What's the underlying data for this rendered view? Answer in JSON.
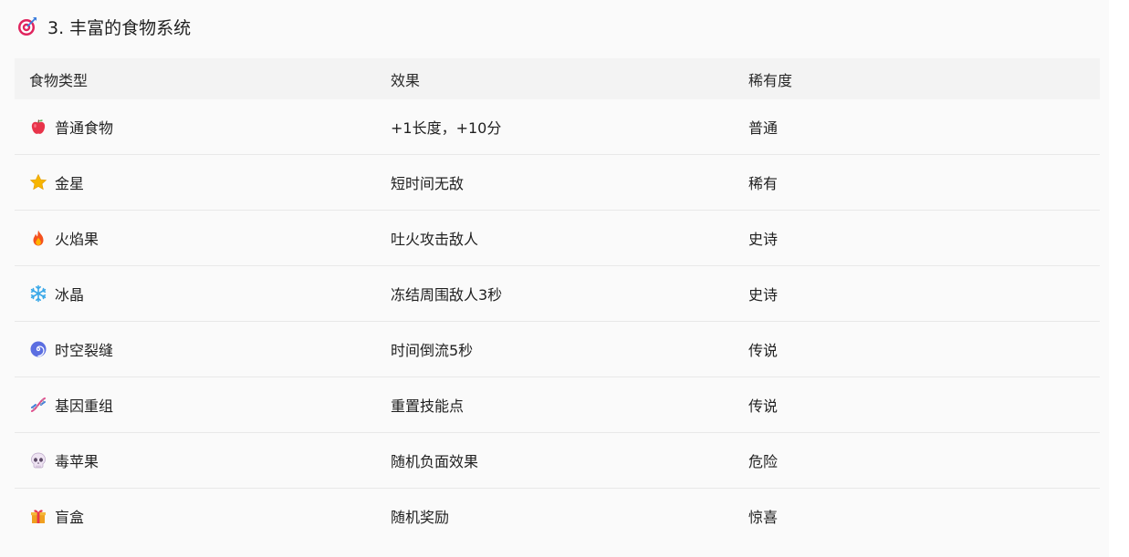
{
  "heading": {
    "title": "3. 丰富的食物系统",
    "icon": "target-icon"
  },
  "table": {
    "columns": [
      "食物类型",
      "效果",
      "稀有度"
    ],
    "rows": [
      {
        "icon": "apple-icon",
        "name": "普通食物",
        "effect": "+1长度，+10分",
        "rarity": "普通"
      },
      {
        "icon": "star-icon",
        "name": "金星",
        "effect": "短时间无敌",
        "rarity": "稀有"
      },
      {
        "icon": "fire-icon",
        "name": "火焰果",
        "effect": "吐火攻击敌人",
        "rarity": "史诗"
      },
      {
        "icon": "snowflake-icon",
        "name": "冰晶",
        "effect": "冻结周围敌人3秒",
        "rarity": "史诗"
      },
      {
        "icon": "cyclone-icon",
        "name": "时空裂缝",
        "effect": "时间倒流5秒",
        "rarity": "传说"
      },
      {
        "icon": "dna-icon",
        "name": "基因重组",
        "effect": "重置技能点",
        "rarity": "传说"
      },
      {
        "icon": "skull-icon",
        "name": "毒苹果",
        "effect": "随机负面效果",
        "rarity": "危险"
      },
      {
        "icon": "gift-icon",
        "name": "盲盒",
        "effect": "随机奖励",
        "rarity": "惊喜"
      }
    ]
  }
}
